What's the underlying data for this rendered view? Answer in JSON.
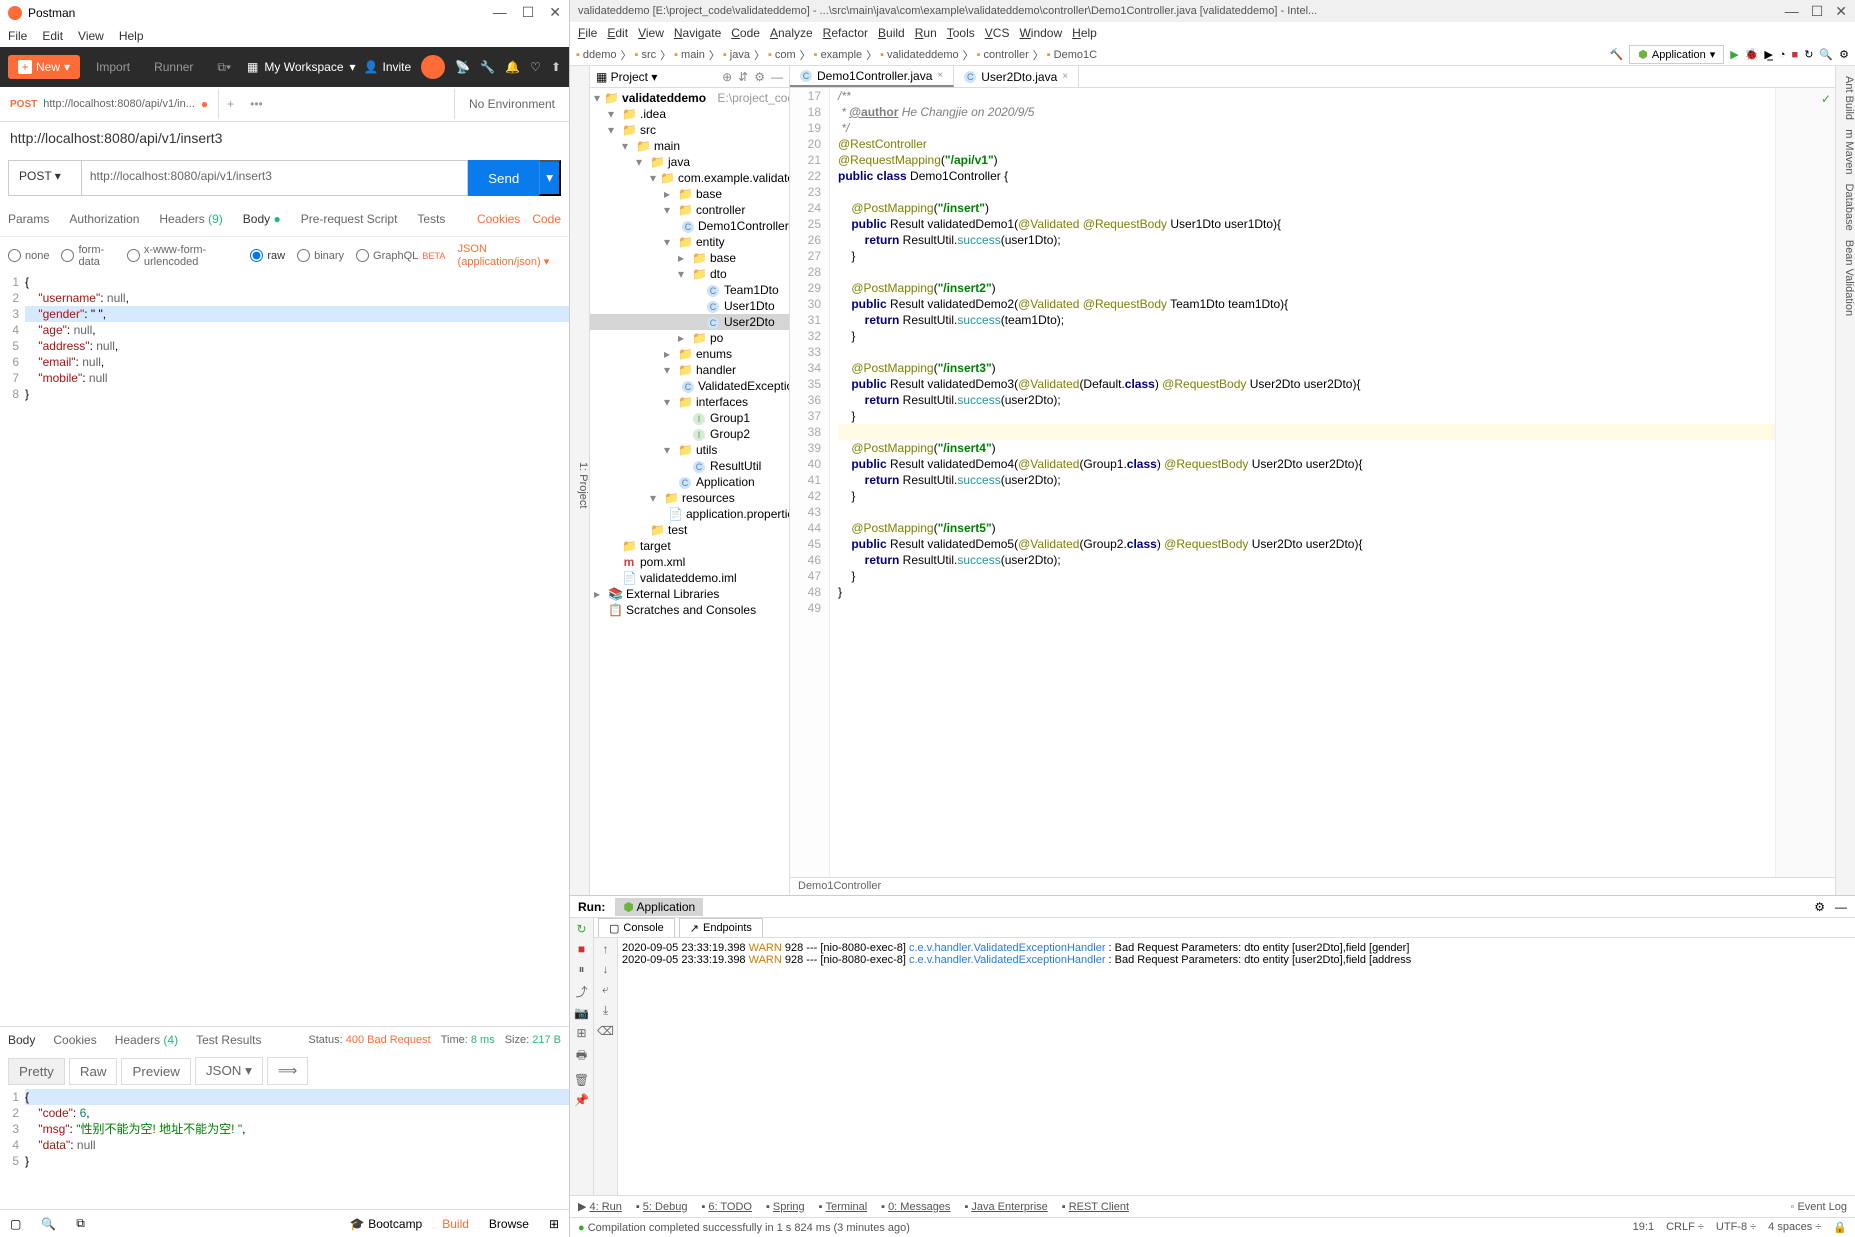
{
  "postman": {
    "title": "Postman",
    "menu": [
      "File",
      "Edit",
      "View",
      "Help"
    ],
    "toolbar": {
      "new": "New",
      "import": "Import",
      "runner": "Runner",
      "workspace": "My Workspace",
      "invite": "Invite"
    },
    "env": "No Environment",
    "tab": {
      "method": "POST",
      "title": "http://localhost:8080/api/v1/in..."
    },
    "url_title": "http://localhost:8080/api/v1/insert3",
    "request": {
      "method": "POST",
      "url": "http://localhost:8080/api/v1/insert3",
      "send": "Send"
    },
    "req_tabs": {
      "params": "Params",
      "auth": "Authorization",
      "headers": "Headers",
      "headers_count": "(9)",
      "body": "Body",
      "prereq": "Pre-request Script",
      "tests": "Tests",
      "cookies": "Cookies",
      "code": "Code"
    },
    "body_types": {
      "none": "none",
      "formdata": "form-data",
      "urlencoded": "x-www-form-urlencoded",
      "raw": "raw",
      "binary": "binary",
      "graphql": "GraphQL",
      "beta": "BETA",
      "content_type": "JSON (application/json)"
    },
    "req_body_lines": [
      "{",
      "    \"username\": null,",
      "    \"gender\": \" \",",
      "    \"age\": null,",
      "    \"address\": null,",
      "    \"email\": null,",
      "    \"mobile\": null",
      "}"
    ],
    "resp_tabs": {
      "body": "Body",
      "cookies": "Cookies",
      "headers": "Headers",
      "headers_count": "(4)",
      "tests": "Test Results"
    },
    "resp_status": {
      "status_label": "Status:",
      "status_val": "400 Bad Request",
      "time_label": "Time:",
      "time_val": "8 ms",
      "size_label": "Size:",
      "size_val": "217 B"
    },
    "resp_toolbar": {
      "pretty": "Pretty",
      "raw": "Raw",
      "preview": "Preview",
      "json": "JSON"
    },
    "resp_body_lines": [
      "{",
      "    \"code\": 6,",
      "    \"msg\": \"性别不能为空! 地址不能为空! \",",
      "    \"data\": null",
      "}"
    ],
    "footer": {
      "bootcamp": "Bootcamp",
      "build": "Build",
      "browse": "Browse"
    }
  },
  "intellij": {
    "title": "validateddemo [E:\\project_code\\validateddemo] - ...\\src\\main\\java\\com\\example\\validateddemo\\controller\\Demo1Controller.java [validateddemo] - Intel...",
    "menu": [
      "File",
      "Edit",
      "View",
      "Navigate",
      "Code",
      "Analyze",
      "Refactor",
      "Build",
      "Run",
      "Tools",
      "VCS",
      "Window",
      "Help"
    ],
    "breadcrumb": [
      "ddemo",
      "src",
      "main",
      "java",
      "com",
      "example",
      "validateddemo",
      "controller",
      "Demo1C"
    ],
    "run_config": "Application",
    "project_label": "Project",
    "project_root": {
      "name": "validateddemo",
      "path": "E:\\project_code\\validatedden"
    },
    "tree": [
      {
        "indent": 1,
        "arrow": "▾",
        "icon": "folder",
        "label": ".idea"
      },
      {
        "indent": 1,
        "arrow": "▾",
        "icon": "src",
        "label": "src"
      },
      {
        "indent": 2,
        "arrow": "▾",
        "icon": "src",
        "label": "main"
      },
      {
        "indent": 3,
        "arrow": "▾",
        "icon": "src",
        "label": "java"
      },
      {
        "indent": 4,
        "arrow": "▾",
        "icon": "folder",
        "label": "com.example.validateddemo"
      },
      {
        "indent": 5,
        "arrow": "▸",
        "icon": "folder",
        "label": "base"
      },
      {
        "indent": 5,
        "arrow": "▾",
        "icon": "folder",
        "label": "controller"
      },
      {
        "indent": 6,
        "arrow": "",
        "icon": "class",
        "label": "Demo1Controller"
      },
      {
        "indent": 5,
        "arrow": "▾",
        "icon": "folder",
        "label": "entity"
      },
      {
        "indent": 6,
        "arrow": "▸",
        "icon": "folder",
        "label": "base"
      },
      {
        "indent": 6,
        "arrow": "▾",
        "icon": "folder",
        "label": "dto"
      },
      {
        "indent": 7,
        "arrow": "",
        "icon": "class",
        "label": "Team1Dto"
      },
      {
        "indent": 7,
        "arrow": "",
        "icon": "class",
        "label": "User1Dto"
      },
      {
        "indent": 7,
        "arrow": "",
        "icon": "class",
        "label": "User2Dto",
        "sel": true
      },
      {
        "indent": 6,
        "arrow": "▸",
        "icon": "folder",
        "label": "po"
      },
      {
        "indent": 5,
        "arrow": "▸",
        "icon": "folder",
        "label": "enums"
      },
      {
        "indent": 5,
        "arrow": "▾",
        "icon": "folder",
        "label": "handler"
      },
      {
        "indent": 6,
        "arrow": "",
        "icon": "class",
        "label": "ValidatedExceptionHandl"
      },
      {
        "indent": 5,
        "arrow": "▾",
        "icon": "folder",
        "label": "interfaces"
      },
      {
        "indent": 6,
        "arrow": "",
        "icon": "iface",
        "label": "Group1"
      },
      {
        "indent": 6,
        "arrow": "",
        "icon": "iface",
        "label": "Group2"
      },
      {
        "indent": 5,
        "arrow": "▾",
        "icon": "folder",
        "label": "utils"
      },
      {
        "indent": 6,
        "arrow": "",
        "icon": "class",
        "label": "ResultUtil"
      },
      {
        "indent": 5,
        "arrow": "",
        "icon": "class",
        "label": "Application"
      },
      {
        "indent": 4,
        "arrow": "▾",
        "icon": "folder",
        "label": "resources"
      },
      {
        "indent": 5,
        "arrow": "",
        "icon": "file",
        "label": "application.properties"
      },
      {
        "indent": 3,
        "arrow": "",
        "icon": "src-test",
        "label": "test"
      },
      {
        "indent": 1,
        "arrow": "",
        "icon": "target",
        "label": "target"
      },
      {
        "indent": 1,
        "arrow": "",
        "icon": "m",
        "label": "pom.xml"
      },
      {
        "indent": 1,
        "arrow": "",
        "icon": "file",
        "label": "validateddemo.iml"
      },
      {
        "indent": 0,
        "arrow": "▸",
        "icon": "lib",
        "label": "External Libraries"
      },
      {
        "indent": 0,
        "arrow": "",
        "icon": "scratch",
        "label": "Scratches and Consoles"
      }
    ],
    "editor_tabs": [
      {
        "name": "Demo1Controller.java",
        "active": true
      },
      {
        "name": "User2Dto.java",
        "active": false
      }
    ],
    "code_start_line": 17,
    "code_lines": [
      {
        "html": "<span class='k-doc'>/**</span>"
      },
      {
        "html": "<span class='k-doc'> * </span><span class='k-tag'>@author</span><span class='k-doc'> He Changjie on 2020/9/5</span>"
      },
      {
        "html": "<span class='k-doc'> */</span>"
      },
      {
        "html": "<span class='k-ann'>@RestController</span>"
      },
      {
        "html": "<span class='k-ann'>@RequestMapping</span>(<span class='k-str'>\"/api/v1\"</span>)"
      },
      {
        "html": "<span class='k-kw'>public class</span> Demo1Controller {"
      },
      {
        "html": ""
      },
      {
        "html": "    <span class='k-ann'>@PostMapping</span>(<span class='k-str'>\"/insert\"</span>)"
      },
      {
        "html": "    <span class='k-kw'>public</span> Result validatedDemo1(<span class='k-ann'>@Validated</span> <span class='k-ann'>@RequestBody</span> User1Dto user1Dto){"
      },
      {
        "html": "        <span class='k-kw'>return</span> ResultUtil.<span class='k-type'>success</span>(user1Dto);"
      },
      {
        "html": "    }"
      },
      {
        "html": ""
      },
      {
        "html": "    <span class='k-ann'>@PostMapping</span>(<span class='k-str'>\"/insert2\"</span>)"
      },
      {
        "html": "    <span class='k-kw'>public</span> Result validatedDemo2(<span class='k-ann'>@Validated</span> <span class='k-ann'>@RequestBody</span> Team1Dto team1Dto){"
      },
      {
        "html": "        <span class='k-kw'>return</span> ResultUtil.<span class='k-type'>success</span>(team1Dto);"
      },
      {
        "html": "    }"
      },
      {
        "html": ""
      },
      {
        "html": "    <span class='k-ann'>@PostMapping</span>(<span class='k-str'>\"/insert3\"</span>)"
      },
      {
        "html": "    <span class='k-kw'>public</span> Result validatedDemo3(<span class='k-ann'>@Validated</span>(Default.<span class='k-kw'>class</span>) <span class='k-ann'>@RequestBody</span> User2Dto user2Dto){"
      },
      {
        "html": "        <span class='k-kw'>return</span> ResultUtil.<span class='k-type'>success</span>(user2Dto);"
      },
      {
        "html": "    }"
      },
      {
        "html": "",
        "hl": true
      },
      {
        "html": "    <span class='k-ann'>@PostMapping</span>(<span class='k-str'>\"/insert4\"</span>)"
      },
      {
        "html": "    <span class='k-kw'>public</span> Result validatedDemo4(<span class='k-ann'>@Validated</span>(Group1.<span class='k-kw'>class</span>) <span class='k-ann'>@RequestBody</span> User2Dto user2Dto){"
      },
      {
        "html": "        <span class='k-kw'>return</span> ResultUtil.<span class='k-type'>success</span>(user2Dto);"
      },
      {
        "html": "    }"
      },
      {
        "html": ""
      },
      {
        "html": "    <span class='k-ann'>@PostMapping</span>(<span class='k-str'>\"/insert5\"</span>)"
      },
      {
        "html": "    <span class='k-kw'>public</span> Result validatedDemo5(<span class='k-ann'>@Validated</span>(Group2.<span class='k-kw'>class</span>) <span class='k-ann'>@RequestBody</span> User2Dto user2Dto){"
      },
      {
        "html": "        <span class='k-kw'>return</span> ResultUtil.<span class='k-type'>success</span>(user2Dto);"
      },
      {
        "html": "    }"
      },
      {
        "html": "}"
      },
      {
        "html": ""
      }
    ],
    "editor_breadcrumb": "Demo1Controller",
    "run_label": "Run:",
    "run_tab": "Application",
    "console_tabs": {
      "console": "Console",
      "endpoints": "Endpoints"
    },
    "console_lines": [
      {
        "ts": "2020-09-05 23:33:19.398",
        "level": "WARN",
        "thread": "928",
        "src": "[nio-8080-exec-8]",
        "logger": "c.e.v.handler.ValidatedExceptionHandler",
        "msg": "Bad Request Parameters: dto entity [user2Dto],field [gender]"
      },
      {
        "ts": "2020-09-05 23:33:19.398",
        "level": "WARN",
        "thread": "928",
        "src": "[nio-8080-exec-8]",
        "logger": "c.e.v.handler.ValidatedExceptionHandler",
        "msg": "Bad Request Parameters: dto entity [user2Dto],field [address"
      }
    ],
    "bottom_bar": [
      "4: Run",
      "5: Debug",
      "6: TODO",
      "Spring",
      "Terminal",
      "0: Messages",
      "Java Enterprise",
      "REST Client"
    ],
    "event_log": "Event Log",
    "status_msg": "Compilation completed successfully in 1 s 824 ms (3 minutes ago)",
    "status_right": [
      "19:1",
      "CRLF ÷",
      "UTF-8 ÷",
      "4 spaces ÷"
    ]
  }
}
